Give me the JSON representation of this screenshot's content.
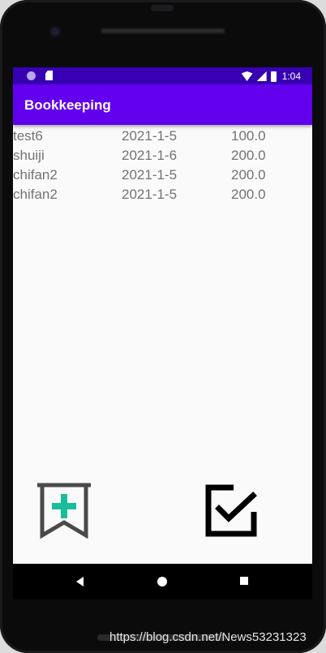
{
  "status_bar": {
    "time": "1:04",
    "icons": [
      "circle-notification-icon",
      "sd-card-icon",
      "wifi-icon",
      "signal-icon",
      "battery-icon"
    ]
  },
  "app_bar": {
    "title": "Bookkeeping",
    "color": "#6200ee",
    "status_color": "#3700b3"
  },
  "records": [
    {
      "name": "test6",
      "date": "2021-1-5",
      "amount": "100.0"
    },
    {
      "name": "shuiji",
      "date": "2021-1-6",
      "amount": "200.0"
    },
    {
      "name": "chifan2",
      "date": "2021-1-5",
      "amount": "200.0"
    },
    {
      "name": "chifan2",
      "date": "2021-1-5",
      "amount": "200.0"
    }
  ],
  "buttons": {
    "add_icon": "bookmark-add-icon",
    "add_accent": "#1abc9c",
    "done_icon": "check-box-icon"
  },
  "nav_bar": {
    "icons": [
      "back-icon",
      "home-icon",
      "recents-icon"
    ]
  },
  "watermark": "https://blog.csdn.net/News53231323"
}
